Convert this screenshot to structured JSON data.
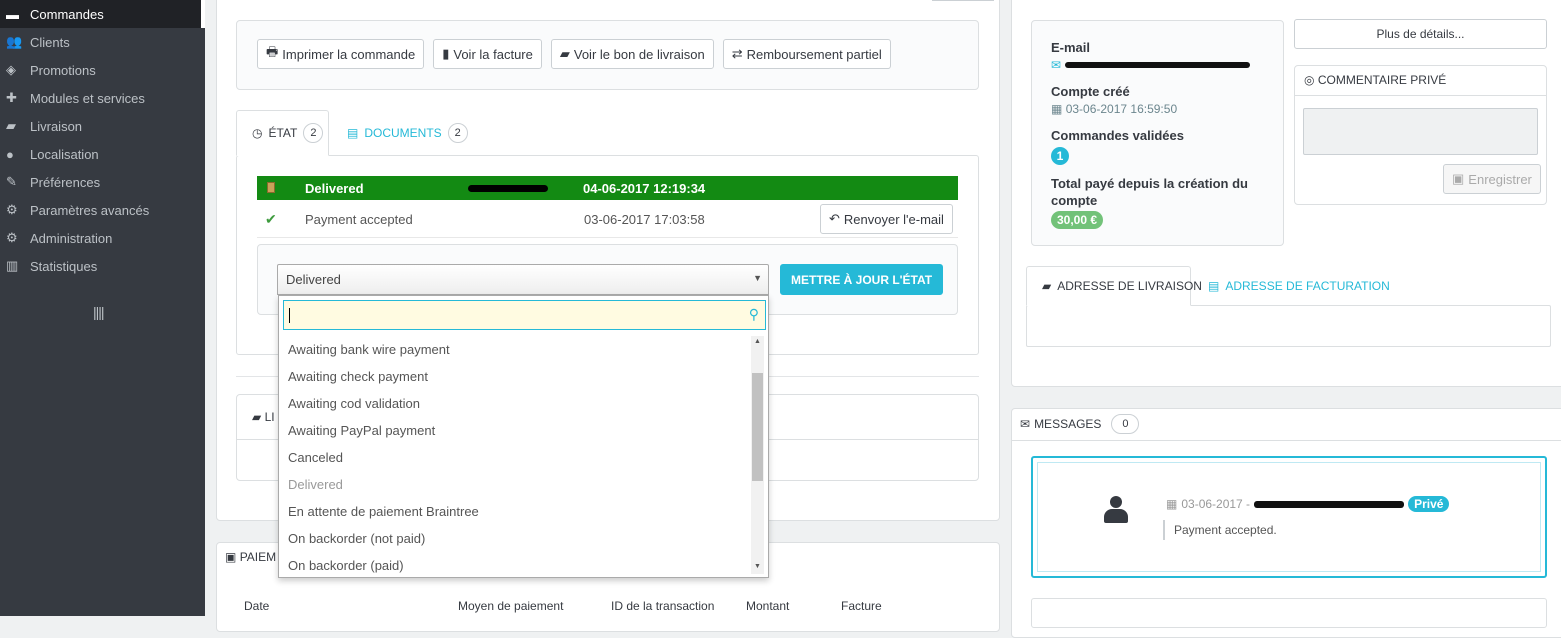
{
  "sidebar": {
    "items": [
      {
        "label": "Commandes",
        "icon": "credit-card-icon",
        "glyph": "▬"
      },
      {
        "label": "Clients",
        "icon": "users-icon",
        "glyph": "👥"
      },
      {
        "label": "Promotions",
        "icon": "tag-icon",
        "glyph": "◈"
      },
      {
        "label": "Modules et services",
        "icon": "puzzle-icon",
        "glyph": "✚"
      },
      {
        "label": "Livraison",
        "icon": "truck-icon",
        "glyph": "▰"
      },
      {
        "label": "Localisation",
        "icon": "globe-icon",
        "glyph": "●"
      },
      {
        "label": "Préférences",
        "icon": "wrench-icon",
        "glyph": "✎"
      },
      {
        "label": "Paramètres avancés",
        "icon": "cogs-icon",
        "glyph": "⚙"
      },
      {
        "label": "Administration",
        "icon": "cog-icon",
        "glyph": "⚙"
      },
      {
        "label": "Statistiques",
        "icon": "bar-chart-icon",
        "glyph": "▥"
      }
    ],
    "collapse_glyph": "||||"
  },
  "actions": {
    "print": "Imprimer la commande",
    "invoice": "Voir la facture",
    "delivery_slip": "Voir le bon de livraison",
    "refund": "Remboursement partiel"
  },
  "tabs": {
    "state_label": "ÉTAT",
    "state_count": "2",
    "documents_label": "DOCUMENTS",
    "documents_count": "2"
  },
  "states": [
    {
      "name": "Delivered",
      "date": "04-06-2017 12:19:34"
    },
    {
      "name": "Payment accepted",
      "date": "03-06-2017 17:03:58",
      "action": "Renvoyer l'e-mail"
    }
  ],
  "state_form": {
    "selected": "Delivered",
    "update_button": "METTRE À JOUR L'ÉTAT"
  },
  "dropdown_options": [
    {
      "label": "Awaiting bank wire payment",
      "disabled": false
    },
    {
      "label": "Awaiting check payment",
      "disabled": false
    },
    {
      "label": "Awaiting cod validation",
      "disabled": false
    },
    {
      "label": "Awaiting PayPal payment",
      "disabled": false
    },
    {
      "label": "Canceled",
      "disabled": false
    },
    {
      "label": "Delivered",
      "disabled": true
    },
    {
      "label": "En attente de paiement Braintree",
      "disabled": false
    },
    {
      "label": "On backorder (not paid)",
      "disabled": false
    },
    {
      "label": "On backorder (paid)",
      "disabled": false
    }
  ],
  "shipping_panel_prefix": "LI",
  "payment_panel_title": "PAIEM",
  "payment_table_headers": [
    "Date",
    "Moyen de paiement",
    "ID de la transaction",
    "Montant",
    "Facture"
  ],
  "customer": {
    "email_label": "E-mail",
    "account_created_label": "Compte créé",
    "account_created_value": "03-06-2017 16:59:50",
    "valid_orders_label": "Commandes validées",
    "valid_orders_value": "1",
    "total_paid_label": "Total payé depuis la création du compte",
    "total_paid_value": "30,00 €"
  },
  "more_details_button": "Plus de détails...",
  "private_note": {
    "title": "COMMENTAIRE PRIVÉ",
    "save_button": "Enregistrer"
  },
  "address_tabs": {
    "shipping": "ADRESSE DE LIVRAISON",
    "invoice": "ADRESSE DE FACTURATION"
  },
  "messages": {
    "title": "MESSAGES",
    "count": "0",
    "items": [
      {
        "date": "03-06-2017 -",
        "badge": "Privé",
        "text": "Payment accepted."
      }
    ]
  }
}
